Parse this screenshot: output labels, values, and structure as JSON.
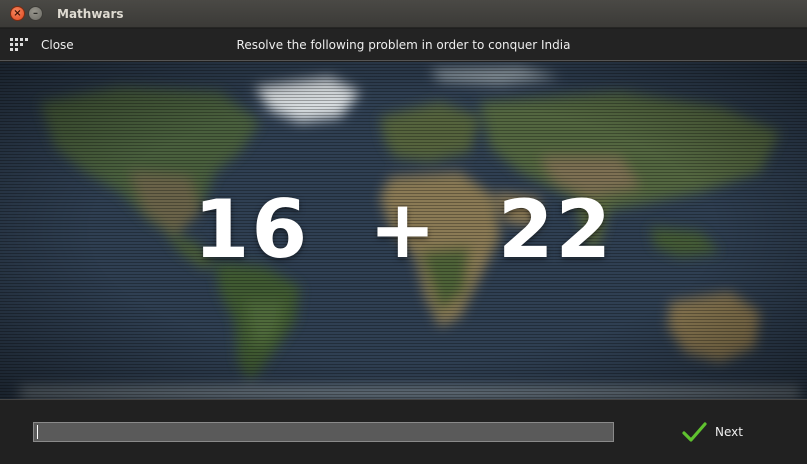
{
  "window": {
    "title": "Mathwars",
    "close_glyph": "×",
    "minimize_glyph": "–"
  },
  "toolbar": {
    "menu_icon": "grid-icon",
    "close_label": "Close",
    "instruction": "Resolve the following problem in order to conquer India"
  },
  "problem": {
    "operand_a": "16",
    "operator": "+",
    "operand_b": "22"
  },
  "answer": {
    "value": "",
    "placeholder": ""
  },
  "footer": {
    "next_label": "Next",
    "next_icon": "check-icon"
  },
  "colors": {
    "check": "#5fc22f",
    "close_button": "#e8552a",
    "map_ocean": "#2c3a4c"
  }
}
